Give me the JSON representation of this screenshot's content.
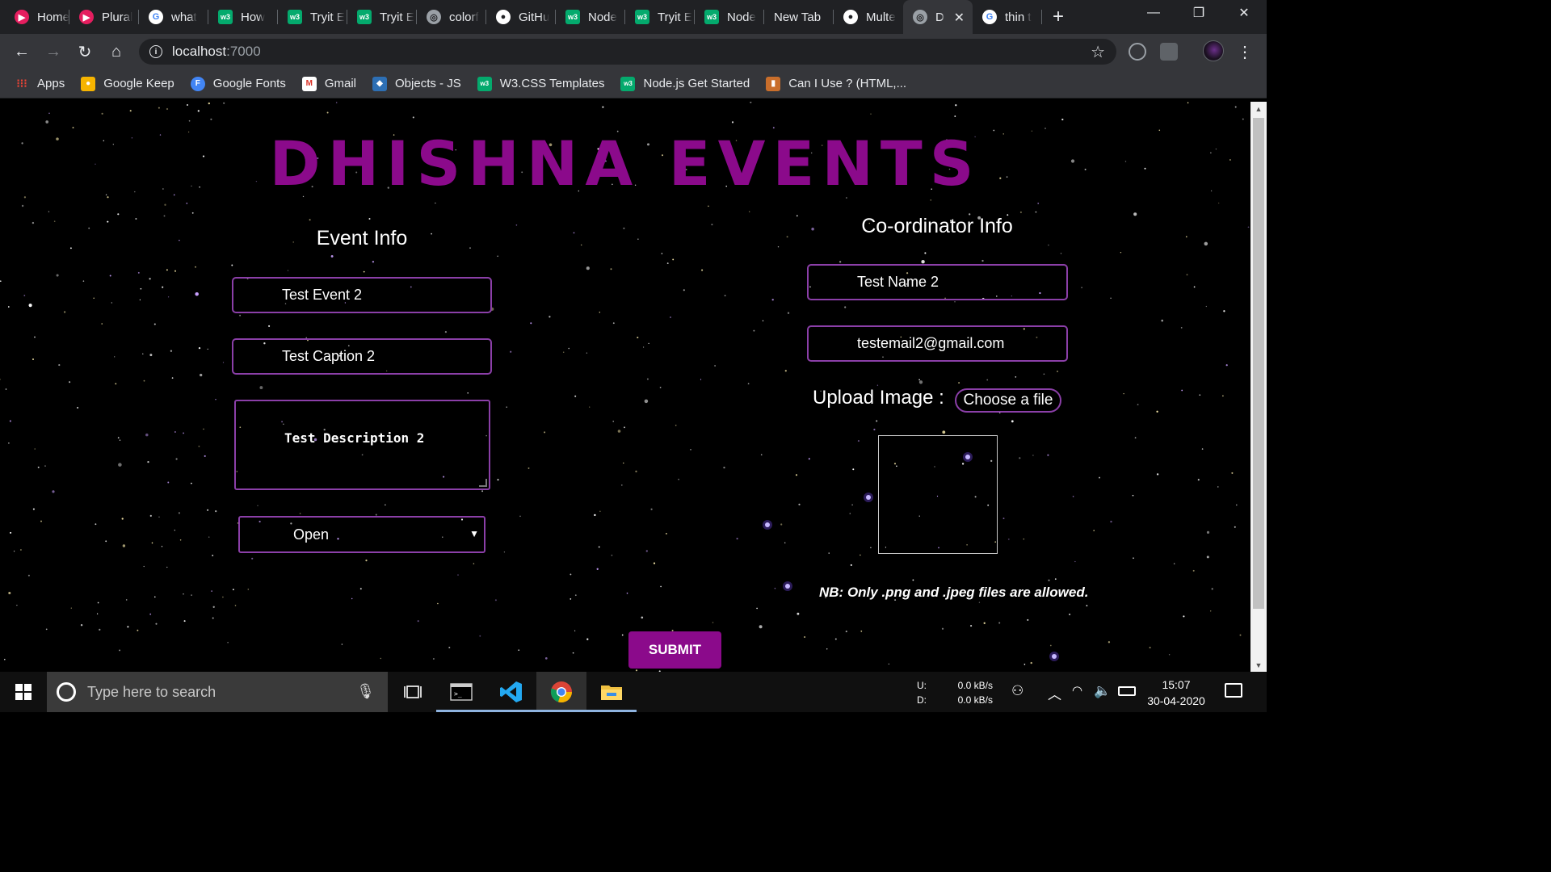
{
  "browser": {
    "tabs": [
      {
        "title": "Home",
        "icon": "pluralsight-icon"
      },
      {
        "title": "Plural",
        "icon": "pluralsight-icon"
      },
      {
        "title": "what",
        "icon": "google-icon"
      },
      {
        "title": "How",
        "icon": "w3schools-icon"
      },
      {
        "title": "Tryit E",
        "icon": "w3schools-icon"
      },
      {
        "title": "Tryit E",
        "icon": "w3schools-icon"
      },
      {
        "title": "colorf",
        "icon": "globe-icon"
      },
      {
        "title": "GitHu",
        "icon": "github-icon"
      },
      {
        "title": "Node",
        "icon": "w3schools-icon"
      },
      {
        "title": "Tryit E",
        "icon": "w3schools-icon"
      },
      {
        "title": "Node",
        "icon": "w3schools-icon"
      },
      {
        "title": "New Tab",
        "icon": ""
      },
      {
        "title": "Multe",
        "icon": "github-icon"
      },
      {
        "title": "D",
        "icon": "globe-icon",
        "active": true
      },
      {
        "title": "thin t",
        "icon": "google-icon"
      }
    ],
    "url_host": "localhost",
    "url_port": ":7000",
    "bookmarks": [
      {
        "label": "Apps",
        "icon": "apps-grid-icon"
      },
      {
        "label": "Google Keep",
        "icon": "google-keep-icon"
      },
      {
        "label": "Google Fonts",
        "icon": "google-fonts-icon"
      },
      {
        "label": "Gmail",
        "icon": "gmail-icon"
      },
      {
        "label": "Objects - JS",
        "icon": "js-objects-icon"
      },
      {
        "label": "W3.CSS Templates",
        "icon": "w3schools-icon"
      },
      {
        "label": "Node.js Get Started",
        "icon": "w3schools-icon"
      },
      {
        "label": "Can I Use ? (HTML,...",
        "icon": "caniuse-icon"
      }
    ]
  },
  "page": {
    "title": "DHISHNA EVENTS",
    "event_info": {
      "heading": "Event Info",
      "event_name": "Test Event 2",
      "caption": "Test Caption 2",
      "description": "Test Description 2",
      "status": "Open"
    },
    "coordinator_info": {
      "heading": "Co-ordinator Info",
      "name": "Test Name 2",
      "email": "testemail2@gmail.com",
      "upload_label": "Upload Image :",
      "choose_file": "Choose a file",
      "note": "NB: Only .png and .jpeg files are allowed."
    },
    "submit_label": "SUBMIT"
  },
  "taskbar": {
    "search_placeholder": "Type here to search",
    "net_upload_label": "U:",
    "net_download_label": "D:",
    "net_upload_value": "0.0 kB/s",
    "net_download_value": "0.0 kB/s",
    "time": "15:07",
    "date": "30-04-2020"
  },
  "colors": {
    "accent_purple": "#8b0a8b",
    "field_border": "#8b3fa8",
    "background": "#000000"
  }
}
